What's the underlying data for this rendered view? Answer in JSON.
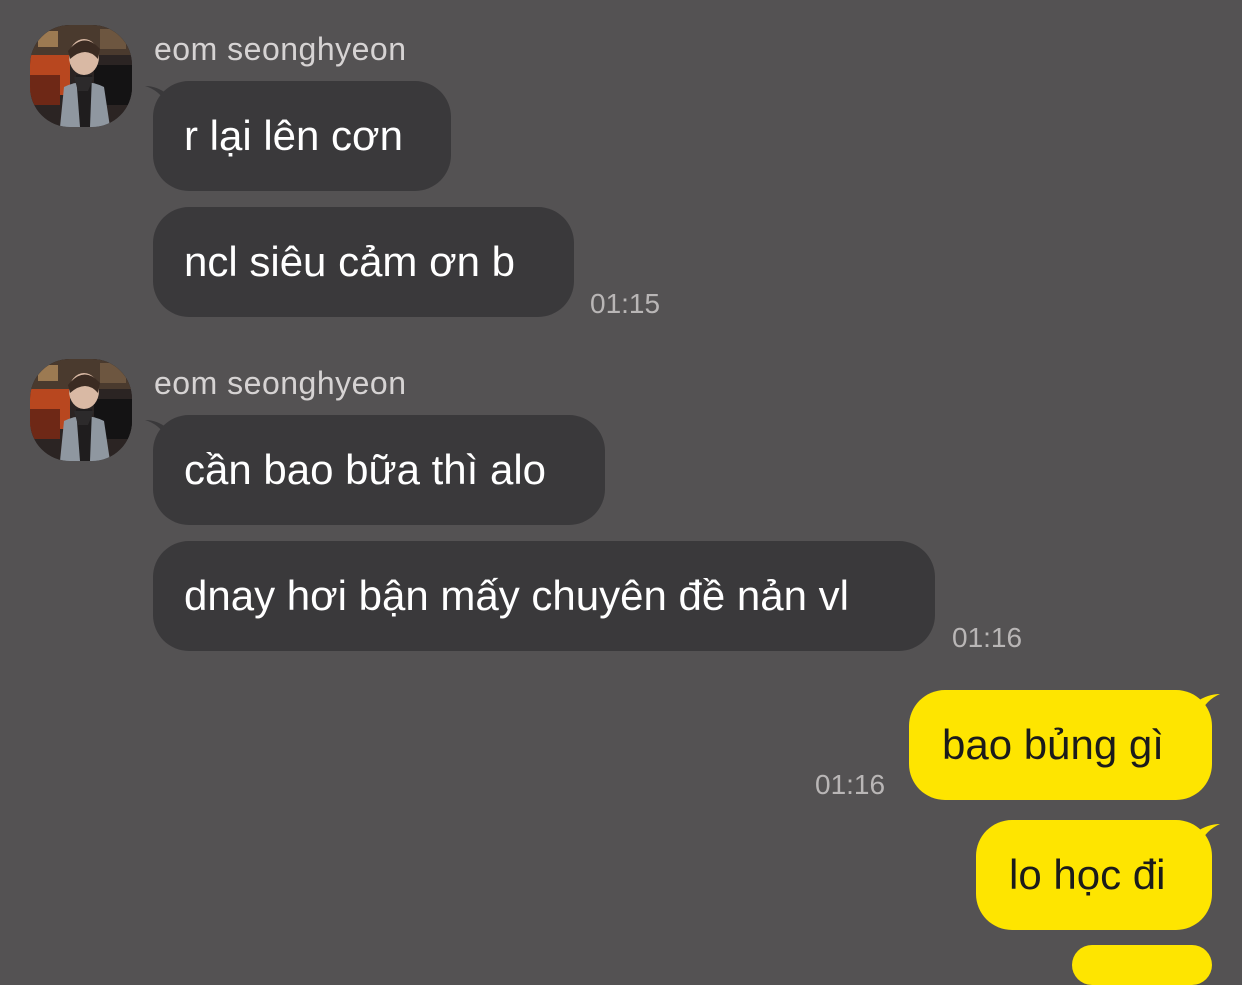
{
  "colors": {
    "background": "#545253",
    "incoming_bubble": "#3a393b",
    "outgoing_bubble": "#fee500",
    "timestamp": "#b9b6b6",
    "sender_name": "#d6d3d3"
  },
  "groups": [
    {
      "sender": "eom seonghyeon",
      "avatar_icon": "profile-photo-avatar",
      "messages": [
        {
          "text": "r lại lên cơn"
        },
        {
          "text": "ncl siêu cảm ơn b"
        }
      ],
      "time": "01:15"
    },
    {
      "sender": "eom seonghyeon",
      "avatar_icon": "profile-photo-avatar",
      "messages": [
        {
          "text": "cần bao bữa thì alo"
        },
        {
          "text": "dnay hơi bận mấy chuyên đề nản vl"
        }
      ],
      "time": "01:16"
    }
  ],
  "outgoing": {
    "messages": [
      {
        "text": "bao bủng gì",
        "time": "01:16"
      },
      {
        "text": "lo học đi"
      }
    ]
  }
}
